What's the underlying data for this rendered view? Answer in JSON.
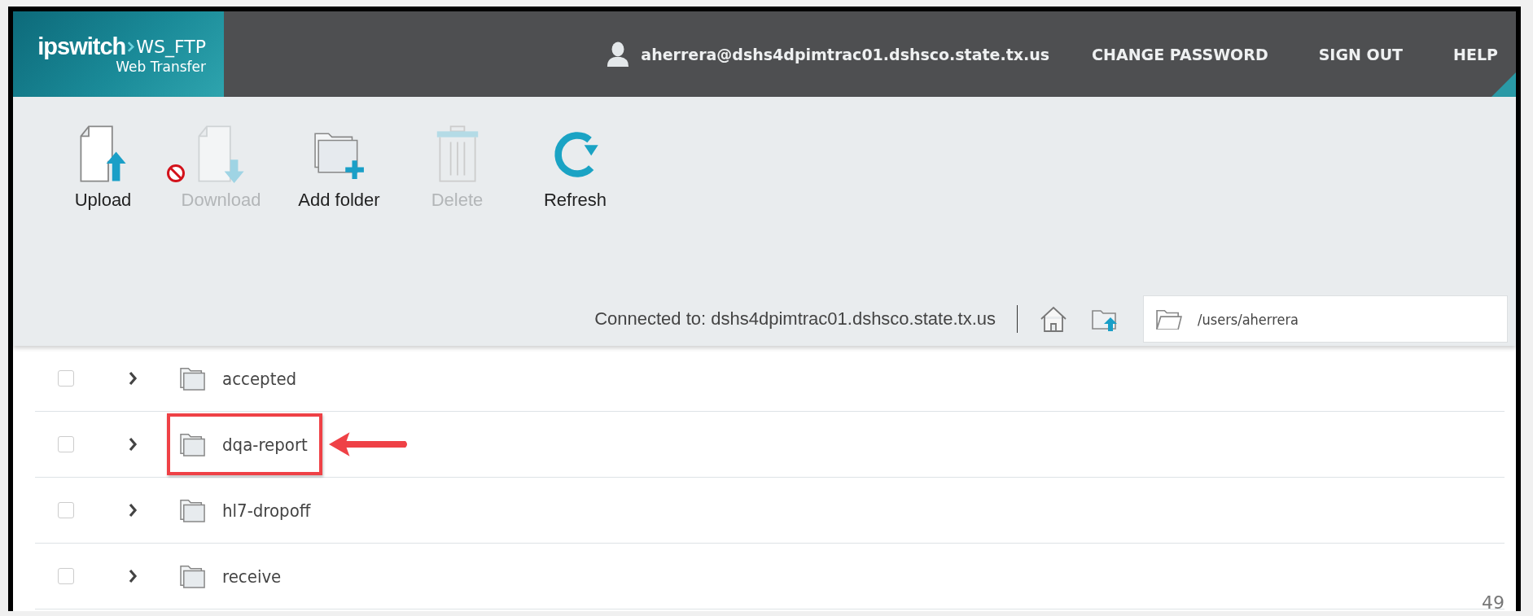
{
  "header": {
    "logo": {
      "brand": "ipswitch",
      "product": "WS_FTP",
      "subtitle": "Web Transfer"
    },
    "user": "aherrera@dshs4dpimtrac01.dshsco.state.tx.us",
    "links": [
      "CHANGE PASSWORD",
      "SIGN OUT",
      "HELP"
    ]
  },
  "toolbar": [
    {
      "kind": "upload",
      "label": "Upload",
      "disabled": false,
      "blocked": false
    },
    {
      "kind": "download",
      "label": "Download",
      "disabled": true,
      "blocked": true
    },
    {
      "kind": "add-folder",
      "label": "Add folder",
      "disabled": false,
      "blocked": false
    },
    {
      "kind": "delete",
      "label": "Delete",
      "disabled": true,
      "blocked": false
    },
    {
      "kind": "refresh",
      "label": "Refresh",
      "disabled": false,
      "blocked": false
    }
  ],
  "connection": {
    "text": "Connected to: dshs4dpimtrac01.dshsco.state.tx.us",
    "path": "/users/aherrera"
  },
  "folders": [
    {
      "name": "accepted",
      "checked": false,
      "highlighted": false
    },
    {
      "name": "dqa-report",
      "checked": false,
      "highlighted": true
    },
    {
      "name": "hl7-dropoff",
      "checked": false,
      "highlighted": false
    },
    {
      "name": "receive",
      "checked": false,
      "highlighted": false
    }
  ],
  "page_number": "49"
}
